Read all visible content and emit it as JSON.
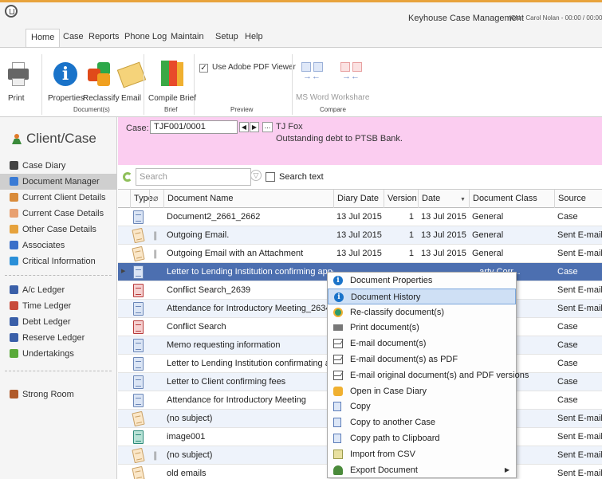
{
  "window": {
    "app_title": "Keyhouse Case Management",
    "user_info": "(CN - Carol Nolan - 00:00 / 00:00)",
    "logo_icon": "keyhouse-logo-icon"
  },
  "menu": {
    "tabs": [
      "Home",
      "Case",
      "Reports",
      "Phone Log",
      "Maintain",
      "Setup",
      "Help"
    ],
    "active": "Home"
  },
  "ribbon": {
    "print_label": "Print",
    "properties_label": "Properties",
    "reclassify_label": "Reclassify",
    "email_label": "Email",
    "documents_group": "Document(s)",
    "compile_brief_label": "Compile Brief",
    "brief_group": "Brief",
    "use_adobe_pdf_label": "Use Adobe PDF Viewer",
    "use_adobe_pdf_checked": true,
    "preview_group": "Preview",
    "ms_word_workshare_label": "MS Word Workshare",
    "compare_group": "Compare"
  },
  "leftnav": {
    "header": "Client/Case",
    "items": [
      {
        "label": "Case Diary",
        "icon": "case-diary-icon",
        "color": "#444444",
        "active": false
      },
      {
        "label": "Document Manager",
        "icon": "document-manager-icon",
        "color": "#3a7bd5",
        "active": true
      },
      {
        "label": "Current Client Details",
        "icon": "client-icon",
        "color": "#d98b3a",
        "active": false
      },
      {
        "label": "Current Case Details",
        "icon": "case-details-icon",
        "color": "#e8a070",
        "active": false
      },
      {
        "label": "Other Case Details",
        "icon": "other-case-icon",
        "color": "#e6a23c",
        "active": false
      },
      {
        "label": "Associates",
        "icon": "associates-icon",
        "color": "#3a6fc9",
        "active": false
      },
      {
        "label": "Critical Information",
        "icon": "critical-info-icon",
        "color": "#2a8fd8",
        "active": false
      },
      {
        "label": "A/c Ledger",
        "icon": "ac-ledger-icon",
        "color": "#3a5fa8",
        "active": false
      },
      {
        "label": "Time Ledger",
        "icon": "time-ledger-icon",
        "color": "#c84a3a",
        "active": false
      },
      {
        "label": "Debt Ledger",
        "icon": "debt-ledger-icon",
        "color": "#3a5fa8",
        "active": false
      },
      {
        "label": "Reserve Ledger",
        "icon": "reserve-ledger-icon",
        "color": "#3a5fa8",
        "active": false
      },
      {
        "label": "Undertakings",
        "icon": "undertakings-icon",
        "color": "#5aaa3a",
        "active": false
      },
      {
        "label": "Strong Room",
        "icon": "strong-room-icon",
        "color": "#b05a2a",
        "active": false
      }
    ]
  },
  "case": {
    "label": "Case:",
    "number": "TJF001/0001",
    "ellipsis": "...",
    "client": "TJ Fox",
    "description": "Outstanding debt to PTSB Bank."
  },
  "search": {
    "placeholder": "Search",
    "search_text_label": "Search text"
  },
  "grid": {
    "columns": [
      "Type",
      "",
      "Document Name",
      "Diary Date",
      "Version",
      "Date",
      "Document Class",
      "Source"
    ],
    "rows": [
      {
        "type": "word",
        "clip": false,
        "name": "Document2_2661_2662",
        "diary_date": "13 Jul 2015",
        "version": "1",
        "date": "13 Jul 2015",
        "class": "General",
        "source": "Case"
      },
      {
        "type": "mail",
        "clip": true,
        "name": "Outgoing Email.",
        "diary_date": "13 Jul 2015",
        "version": "1",
        "date": "13 Jul 2015",
        "class": "General",
        "source": "Sent E-mail"
      },
      {
        "type": "mail",
        "clip": true,
        "name": "Outgoing Email with an Attachment",
        "diary_date": "13 Jul 2015",
        "version": "1",
        "date": "13 Jul 2015",
        "class": "General",
        "source": "Sent E-mail"
      },
      {
        "type": "word",
        "clip": false,
        "name": "Letter to Lending Institution confirming appoint...",
        "diary_date": "",
        "version": "",
        "date": "",
        "class": "...arty Corr...",
        "source": "Case",
        "selected": true
      },
      {
        "type": "pdf",
        "clip": false,
        "name": "Conflict Search_2639",
        "diary_date": "",
        "version": "",
        "date": "",
        "class": "",
        "source": "Sent E-mail"
      },
      {
        "type": "word",
        "clip": false,
        "name": "Attendance for Introductory Meeting_2634",
        "diary_date": "",
        "version": "",
        "date": "",
        "class": "",
        "source": "Sent E-mail"
      },
      {
        "type": "pdf",
        "clip": false,
        "name": "Conflict Search",
        "diary_date": "",
        "version": "",
        "date": "",
        "class": "h",
        "source": "Case"
      },
      {
        "type": "word",
        "clip": false,
        "name": "Memo requesting information",
        "diary_date": "",
        "version": "",
        "date": "",
        "class": "",
        "source": "Case"
      },
      {
        "type": "word",
        "clip": false,
        "name": "Letter to Lending Institution confirmating appoin...",
        "diary_date": "",
        "version": "",
        "date": "",
        "class": "arty Corr...",
        "source": "Case"
      },
      {
        "type": "word",
        "clip": false,
        "name": "Letter to Client confirming fees",
        "diary_date": "",
        "version": "",
        "date": "",
        "class": "",
        "source": "Case"
      },
      {
        "type": "word",
        "clip": false,
        "name": "Attendance for Introductory Meeting",
        "diary_date": "",
        "version": "",
        "date": "",
        "class": "eets",
        "source": "Case"
      },
      {
        "type": "mail",
        "clip": false,
        "name": "(no subject)",
        "diary_date": "",
        "version": "",
        "date": "",
        "class": "",
        "source": "Sent E-mail"
      },
      {
        "type": "img",
        "clip": false,
        "name": "image001",
        "diary_date": "",
        "version": "",
        "date": "",
        "class": "",
        "source": "Sent E-mail"
      },
      {
        "type": "mail",
        "clip": true,
        "name": "(no subject)",
        "diary_date": "",
        "version": "",
        "date": "",
        "class": "",
        "source": "Sent E-mail"
      },
      {
        "type": "mail",
        "clip": false,
        "name": "old emails",
        "diary_date": "",
        "version": "",
        "date": "",
        "class": "",
        "source": "Sent E-mail"
      }
    ]
  },
  "context_menu": {
    "items": [
      {
        "label": "Document Properties",
        "icon": "info-icon",
        "kind": "info"
      },
      {
        "label": "Document History",
        "icon": "info-icon",
        "kind": "info",
        "hover": true
      },
      {
        "label": "Re-classify document(s)",
        "icon": "reclassify-icon",
        "kind": "reclass"
      },
      {
        "label": "Print document(s)",
        "icon": "printer-icon",
        "kind": "print"
      },
      {
        "label": "E-mail document(s)",
        "icon": "email-icon",
        "kind": "mail"
      },
      {
        "label": "E-mail document(s) as PDF",
        "icon": "email-icon",
        "kind": "mail"
      },
      {
        "label": "E-mail original document(s) and PDF versions",
        "icon": "email-icon",
        "kind": "mail"
      },
      {
        "label": "Open in Case Diary",
        "icon": "case-diary-icon",
        "kind": "diary"
      },
      {
        "label": "Copy",
        "icon": "copy-icon",
        "kind": "doc"
      },
      {
        "label": "Copy to another Case",
        "icon": "copy-icon",
        "kind": "doc"
      },
      {
        "label": "Copy path to Clipboard",
        "icon": "copy-icon",
        "kind": "doc"
      },
      {
        "label": "Import from CSV",
        "icon": "import-icon",
        "kind": "import"
      },
      {
        "label": "Export Document",
        "icon": "export-icon",
        "kind": "export",
        "submenu": true
      }
    ]
  }
}
